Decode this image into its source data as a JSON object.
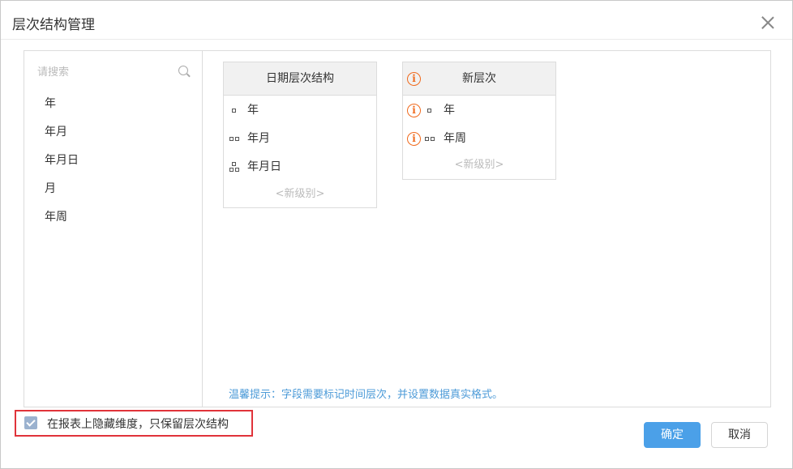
{
  "dialog": {
    "title": "层次结构管理"
  },
  "search": {
    "placeholder": "请搜索"
  },
  "fields": [
    "年",
    "年月",
    "年月日",
    "月",
    "年周"
  ],
  "hierarchies": [
    {
      "name": "日期层次结构",
      "warning": false,
      "levels": [
        {
          "label": "年",
          "icon": "single-square-icon",
          "warning": false
        },
        {
          "label": "年月",
          "icon": "double-square-icon",
          "warning": false
        },
        {
          "label": "年月日",
          "icon": "tree-squares-icon",
          "warning": false
        }
      ],
      "new_level": "<新级别>"
    },
    {
      "name": "新层次",
      "warning": true,
      "levels": [
        {
          "label": "年",
          "icon": "single-square-icon",
          "warning": true
        },
        {
          "label": "年周",
          "icon": "double-square-icon",
          "warning": true
        }
      ],
      "new_level": "<新级别>"
    }
  ],
  "tip": "温馨提示：字段需要标记时间层次，并设置数据真实格式。",
  "hide_option": {
    "label": "在报表上隐藏维度，只保留层次结构",
    "checked": true
  },
  "buttons": {
    "ok": "确定",
    "cancel": "取消"
  },
  "colors": {
    "primary": "#4ba0e8",
    "warning": "#f06a1d",
    "tip": "#4d9bd8",
    "highlight_border": "#e0333a"
  }
}
